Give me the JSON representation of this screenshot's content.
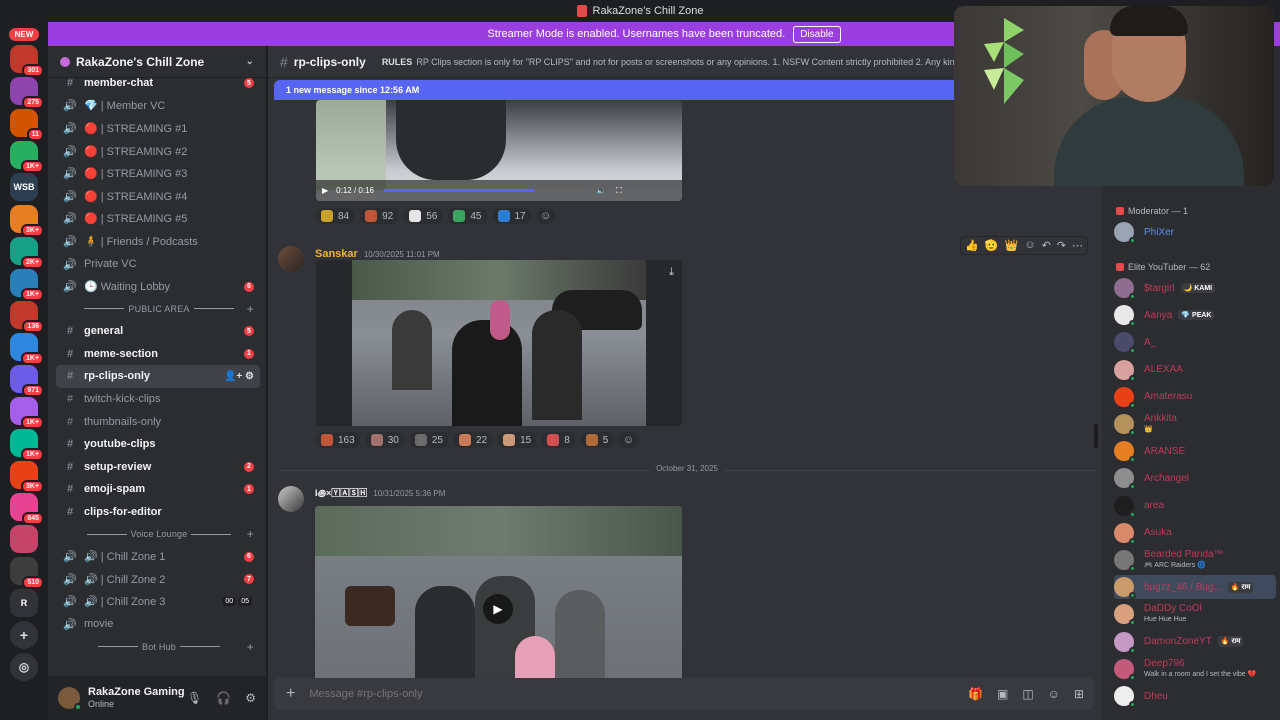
{
  "window_title": "RakaZone's Chill Zone",
  "banner": {
    "text": "Streamer Mode is enabled. Usernames have been truncated.",
    "button": "Disable"
  },
  "guilds": {
    "new_label": "NEW",
    "items": [
      {
        "name": "server-1",
        "badge": "301",
        "color": "#c0392b"
      },
      {
        "name": "server-2",
        "badge": "275",
        "color": "#8e44ad"
      },
      {
        "name": "server-3",
        "badge": "11",
        "color": "#d35400"
      },
      {
        "name": "server-4",
        "badge": "1K+",
        "color": "#27ae60"
      },
      {
        "name": "server-5",
        "badge": "",
        "color": "#2c3e50",
        "label": "WSB"
      },
      {
        "name": "server-6",
        "badge": "3K+",
        "color": "#e67e22"
      },
      {
        "name": "server-7",
        "badge": "2K+",
        "color": "#16a085"
      },
      {
        "name": "server-8",
        "badge": "1K+",
        "color": "#2980b9"
      },
      {
        "name": "server-9",
        "badge": "136",
        "color": "#c0392b"
      },
      {
        "name": "server-10",
        "badge": "1K+",
        "color": "#2e86de"
      },
      {
        "name": "server-11",
        "badge": "971",
        "color": "#6c5ce7"
      },
      {
        "name": "server-12",
        "badge": "1K+",
        "color": "#a55eea"
      },
      {
        "name": "server-13",
        "badge": "1K+",
        "color": "#00b894"
      },
      {
        "name": "server-14",
        "badge": "3K+",
        "color": "#e84118"
      },
      {
        "name": "server-15",
        "badge": "845",
        "color": "#e84393"
      },
      {
        "name": "server-16",
        "badge": "",
        "color": "#c44569"
      },
      {
        "name": "server-17",
        "badge": "510",
        "color": "#3d3d3d"
      },
      {
        "name": "server-18",
        "badge": "",
        "color": "#313338",
        "label": "R"
      }
    ]
  },
  "server": {
    "name": "RakaZone's Chill Zone"
  },
  "channels": [
    {
      "type": "text",
      "icon": "#",
      "label": "member-chat",
      "unread": true,
      "badge": "5"
    },
    {
      "type": "voice",
      "icon": "🔊",
      "label": "💎 | Member VC"
    },
    {
      "type": "voice",
      "icon": "🔊",
      "label": "🔴 | STREAMING #1"
    },
    {
      "type": "voice",
      "icon": "🔊",
      "label": "🔴 | STREAMING #2"
    },
    {
      "type": "voice",
      "icon": "🔊",
      "label": "🔴 | STREAMING #3"
    },
    {
      "type": "voice",
      "icon": "🔊",
      "label": "🔴 | STREAMING #4"
    },
    {
      "type": "voice",
      "icon": "🔊",
      "label": "🔴 | STREAMING #5"
    },
    {
      "type": "voice",
      "icon": "🔊",
      "label": "🧍 | Friends / Podcasts"
    },
    {
      "type": "voice",
      "icon": "🔊",
      "label": "Private VC"
    },
    {
      "type": "voice",
      "icon": "🔊",
      "label": "🕒 Waiting Lobby",
      "badge": "6"
    },
    {
      "type": "category",
      "label": "PUBLIC AREA"
    },
    {
      "type": "text",
      "icon": "#",
      "label": "general",
      "unread": true,
      "badge": "5"
    },
    {
      "type": "text",
      "icon": "#",
      "label": "meme-section",
      "unread": true,
      "badge": "1"
    },
    {
      "type": "text",
      "icon": "#",
      "label": "rp-clips-only",
      "active": true
    },
    {
      "type": "text",
      "icon": "#",
      "label": "twitch-kick-clips"
    },
    {
      "type": "text",
      "icon": "#",
      "label": "thumbnails-only"
    },
    {
      "type": "text",
      "icon": "#",
      "label": "youtube-clips",
      "unread": true
    },
    {
      "type": "text",
      "icon": "#",
      "label": "setup-review",
      "unread": true,
      "badge": "2"
    },
    {
      "type": "text",
      "icon": "#",
      "label": "emoji-spam",
      "unread": true,
      "badge": "1"
    },
    {
      "type": "text",
      "icon": "#",
      "label": "clips-for-editor",
      "unread": true
    },
    {
      "type": "category",
      "label": "Voice Lounge"
    },
    {
      "type": "voice",
      "icon": "🔊",
      "label": "🔊 | Chill Zone 1",
      "badge": "6"
    },
    {
      "type": "voice",
      "icon": "🔊",
      "label": "🔊 | Chill Zone 2",
      "badge": "7"
    },
    {
      "type": "voice",
      "icon": "🔊",
      "label": "🔊 | Chill Zone 3",
      "vc": [
        "00",
        "05"
      ]
    },
    {
      "type": "voice",
      "icon": "🔊",
      "label": "movie"
    },
    {
      "type": "category",
      "label": "Bot Hub"
    }
  ],
  "user": {
    "name": "RakaZone Gaming",
    "status": "Online"
  },
  "channel_header": {
    "name": "rp-clips-only",
    "rules_label": "RULES",
    "rules_text": "RP Clips section is only for \"RP CLIPS\" and not for posts or screenshots or any opinions. 1. NSFW Content strictly prohibited 2. Any kind of"
  },
  "new_messages": "1 new message since 12:56 AM",
  "video1": {
    "time": "0:12 / 0:16"
  },
  "reactions1": [
    {
      "count": "84",
      "color": "#c9a227"
    },
    {
      "count": "92",
      "color": "#c0553a"
    },
    {
      "count": "56",
      "color": "#e6e6e6"
    },
    {
      "count": "45",
      "color": "#3ba55d"
    },
    {
      "count": "17",
      "color": "#2d7dd2"
    }
  ],
  "message2": {
    "author": "Sanskar",
    "timestamp": "10/30/2025 11:01 PM"
  },
  "reactions2": [
    {
      "count": "163",
      "color": "#c0553a"
    },
    {
      "count": "30",
      "color": "#a0726a"
    },
    {
      "count": "25",
      "color": "#6b6b6b"
    },
    {
      "count": "22",
      "color": "#c77b5a"
    },
    {
      "count": "15",
      "color": "#c99a7a"
    },
    {
      "count": "8",
      "color": "#d05050"
    },
    {
      "count": "5",
      "color": "#b06a3a"
    }
  ],
  "date_divider": "October 31, 2025",
  "message3": {
    "author": "I꩜×🅈🄰🅂🄷",
    "timestamp": "10/31/2025 5:36 PM"
  },
  "composer": {
    "placeholder": "Message #rp-clips-only"
  },
  "members": {
    "groups": [
      {
        "label": "Moderator — 1",
        "color": "#e34b4b"
      },
      {
        "label": "Elite YouTuber — 62",
        "color": "#e34b4b"
      }
    ],
    "moderators": [
      {
        "name": "PhiXer",
        "color": "#5b8def",
        "av": "#9aa4b2"
      }
    ],
    "elite": [
      {
        "name": "$targirl",
        "tag": "🌙 KAMI",
        "av": "#8e6e8e"
      },
      {
        "name": "Aanya",
        "tag": "💎 PEAK",
        "av": "#e9e9e9"
      },
      {
        "name": "A_",
        "av": "#4a4a6a"
      },
      {
        "name": "ALEXAA",
        "av": "#d9a0a0"
      },
      {
        "name": "Amaterasu",
        "av": "#e84118"
      },
      {
        "name": "Ankkita",
        "sub": "👑",
        "av": "#b3925c"
      },
      {
        "name": "ARANSE",
        "av": "#e67e22"
      },
      {
        "name": "Archangel",
        "av": "#8e8e8e"
      },
      {
        "name": "area",
        "av": "#1e1e1e"
      },
      {
        "name": "Asuka",
        "av": "#d98a6a"
      },
      {
        "name": "Bearded Panda™",
        "sub": "🎮 ARC Raiders 🌀",
        "av": "#777777"
      },
      {
        "name": "bugzz_46 / Bug...",
        "tag": "🔥 राम",
        "av": "#c99a6a",
        "hl": true
      },
      {
        "name": "DaDDy CoOl",
        "sub": "Hue Hue Hue",
        "av": "#d9a080"
      },
      {
        "name": "DamonZoneYT",
        "tag": "🔥 राम",
        "av": "#c49ac4"
      },
      {
        "name": "Deep796",
        "sub": "Walk in a room and I set the vibe 💔",
        "av": "#c45a7a"
      },
      {
        "name": "Dheu",
        "av": "#eeeeee"
      }
    ]
  }
}
